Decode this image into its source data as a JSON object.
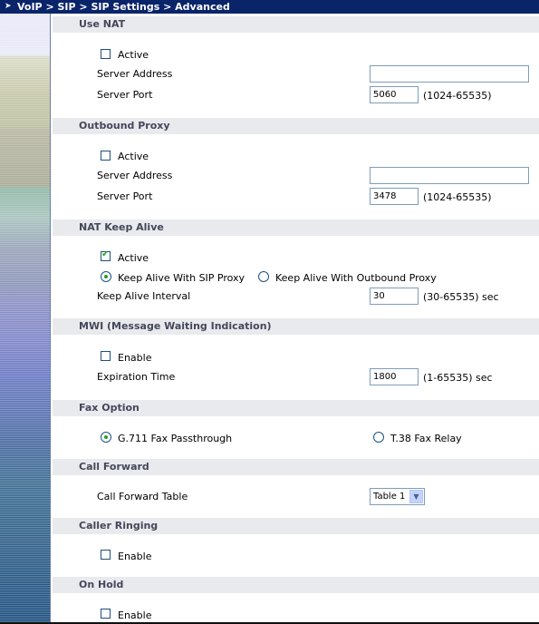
{
  "breadcrumb": "VoIP > SIP > SIP Settings > Advanced",
  "sections": {
    "use_nat": {
      "title": "Use NAT",
      "active_label": "Active",
      "server_address_label": "Server Address",
      "server_address_value": "",
      "server_port_label": "Server Port",
      "server_port_value": "5060",
      "server_port_range": "(1024-65535)"
    },
    "outbound_proxy": {
      "title": "Outbound Proxy",
      "active_label": "Active",
      "server_address_label": "Server Address",
      "server_address_value": "",
      "server_port_label": "Server Port",
      "server_port_value": "3478",
      "server_port_range": "(1024-65535)"
    },
    "nat_keep_alive": {
      "title": "NAT Keep Alive",
      "active_label": "Active",
      "active_checked": true,
      "radio_sip_proxy_label": "Keep Alive With SIP Proxy",
      "radio_outbound_proxy_label": "Keep Alive With Outbound Proxy",
      "interval_label": "Keep Alive Interval",
      "interval_value": "30",
      "interval_range": "(30-65535) sec"
    },
    "mwi": {
      "title": "MWI (Message Waiting Indication)",
      "enable_label": "Enable",
      "expiration_label": "Expiration Time",
      "expiration_value": "1800",
      "expiration_range": "(1-65535) sec"
    },
    "fax_option": {
      "title": "Fax Option",
      "g711_label": "G.711 Fax Passthrough",
      "t38_label": "T.38 Fax Relay"
    },
    "call_forward": {
      "title": "Call Forward",
      "table_label": "Call Forward Table",
      "table_value": "Table 1"
    },
    "caller_ringing": {
      "title": "Caller Ringing",
      "enable_label": "Enable"
    },
    "on_hold": {
      "title": "On Hold",
      "enable_label": "Enable"
    }
  }
}
